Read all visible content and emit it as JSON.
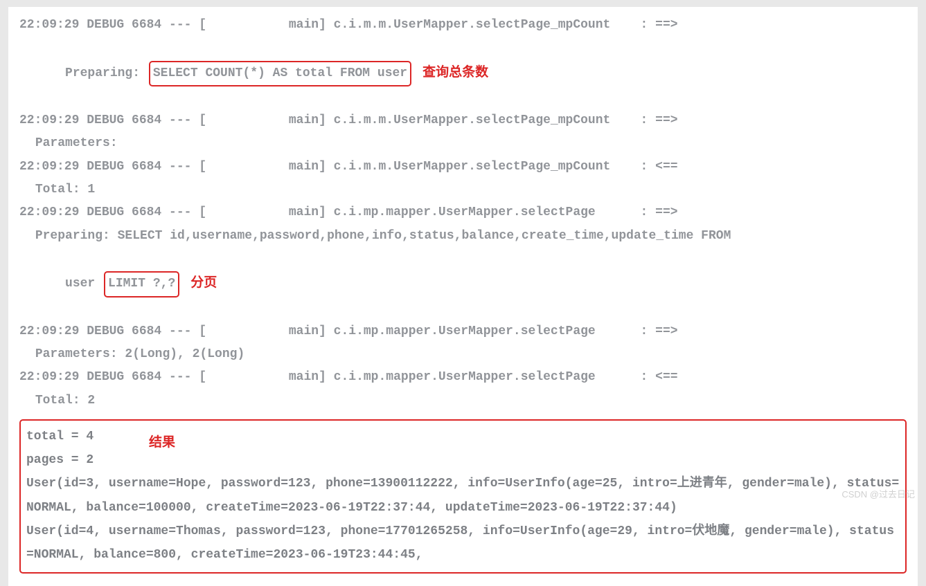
{
  "lines": {
    "l1a": "22:09:29 DEBUG 6684 --- [           main] c.i.m.m.UserMapper.selectPage_mpCount    : ==>",
    "l1b_pre": " Preparing: ",
    "l1b_box": "SELECT COUNT(*) AS total FROM user",
    "anno1": "查询总条数",
    "l2a": "22:09:29 DEBUG 6684 --- [           main] c.i.m.m.UserMapper.selectPage_mpCount    : ==>",
    "l2b": " Parameters:",
    "l3a": "22:09:29 DEBUG 6684 --- [           main] c.i.m.m.UserMapper.selectPage_mpCount    : <==",
    "l3b": " Total: 1",
    "l4a": "22:09:29 DEBUG 6684 --- [           main] c.i.mp.mapper.UserMapper.selectPage      : ==>",
    "l4b": " Preparing: SELECT id,username,password,phone,info,status,balance,create_time,update_time FROM",
    "l4c_pre": " user ",
    "l4c_box": "LIMIT ?,?",
    "anno2": "分页",
    "l5a": "22:09:29 DEBUG 6684 --- [           main] c.i.mp.mapper.UserMapper.selectPage      : ==>",
    "l5b": " Parameters: 2(Long), 2(Long)",
    "l6a": "22:09:29 DEBUG 6684 --- [           main] c.i.mp.mapper.UserMapper.selectPage      : <==",
    "l6b": " Total: 2"
  },
  "result": {
    "anno": "结果",
    "r1": "total = 4",
    "r2": "pages = 2",
    "r3": "User(id=3, username=Hope, password=123, phone=13900112222, info=UserInfo(age=25, intro=上进青年, gender=male), status=NORMAL, balance=100000, createTime=2023-06-19T22:37:44, updateTime=2023-06-19T22:37:44)",
    "r4": "User(id=4, username=Thomas, password=123, phone=17701265258, info=UserInfo(age=29, intro=伏地魔, gender=male), status=NORMAL, balance=800, createTime=2023-06-19T23:44:45,"
  },
  "watermark": "CSDN @过去日记"
}
